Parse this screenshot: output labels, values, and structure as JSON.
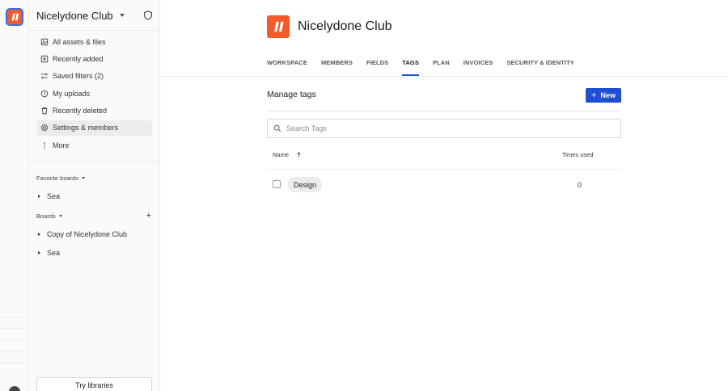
{
  "workspace": {
    "name": "Nicelydone Club"
  },
  "sidebar": {
    "items": [
      {
        "label": "All assets & files",
        "icon": "assets-icon"
      },
      {
        "label": "Recently added",
        "icon": "plus-square-icon"
      },
      {
        "label": "Saved filters (2)",
        "icon": "filter-icon"
      },
      {
        "label": "My uploads",
        "icon": "clock-icon"
      },
      {
        "label": "Recently deleted",
        "icon": "trash-icon"
      },
      {
        "label": "Settings & members",
        "icon": "gear-icon",
        "active": true
      },
      {
        "label": "More",
        "icon": "more-vertical-icon"
      }
    ],
    "favorite_boards": {
      "label": "Favorite boards",
      "items": [
        "Sea"
      ]
    },
    "boards": {
      "label": "Boards",
      "items": [
        "Copy of Nicelydone Club",
        "Sea"
      ]
    },
    "try_libraries": "Try libraries"
  },
  "main": {
    "title": "Nicelydone Club",
    "tabs": [
      {
        "label": "WORKSPACE"
      },
      {
        "label": "MEMBERS"
      },
      {
        "label": "FIELDS"
      },
      {
        "label": "TAGS",
        "active": true
      },
      {
        "label": "PLAN"
      },
      {
        "label": "INVOICES"
      },
      {
        "label": "SECURITY & IDENTITY"
      }
    ],
    "manage_tags": {
      "title": "Manage tags",
      "new_button": "New",
      "search_placeholder": "Search Tags",
      "columns": {
        "name": "Name",
        "times_used": "Times used"
      },
      "rows": [
        {
          "name": "Design",
          "times_used": "0"
        }
      ]
    }
  },
  "colors": {
    "brand": "#f45b2a",
    "accent": "#1f4fd1"
  }
}
